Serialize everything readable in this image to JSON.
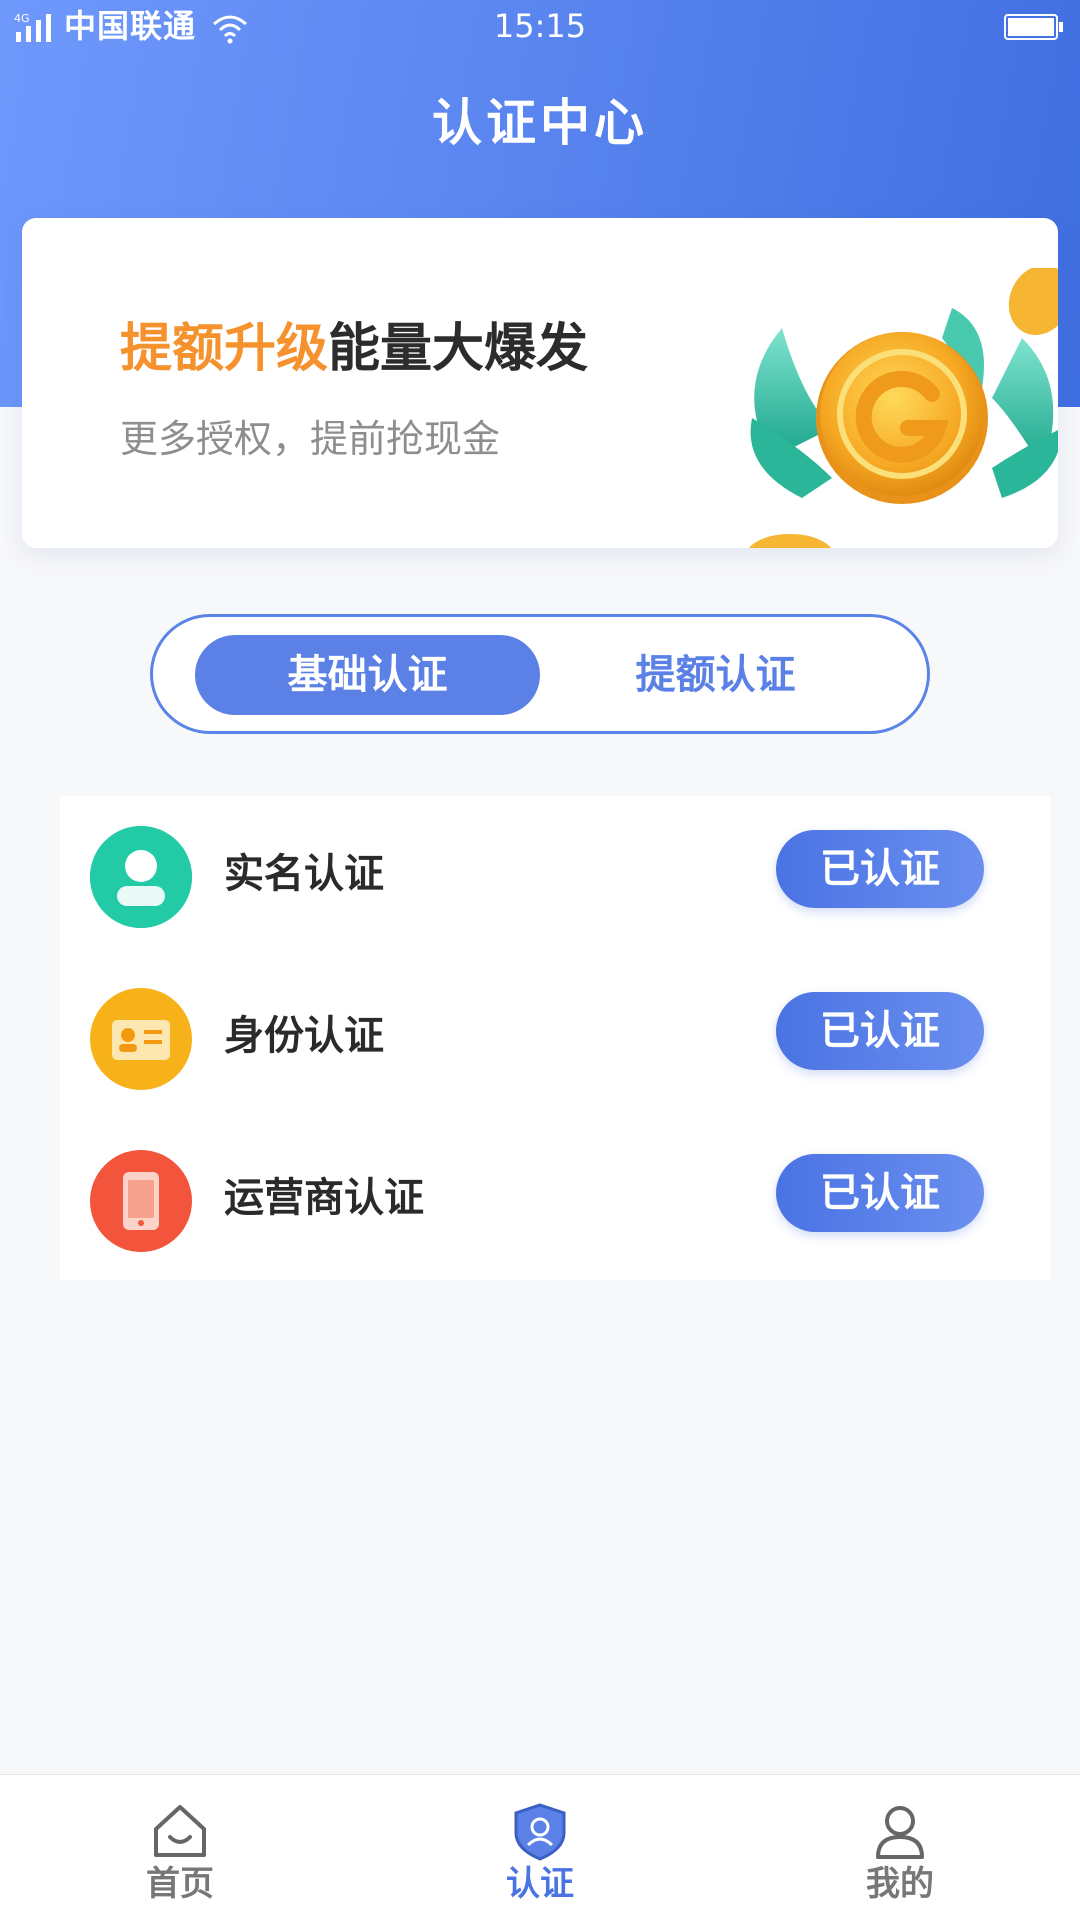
{
  "status_bar": {
    "network": "4G",
    "carrier": "中国联通",
    "time": "15:15"
  },
  "header": {
    "title": "认证中心"
  },
  "banner": {
    "headline_highlight": "提额升级",
    "headline_rest": "能量大爆发",
    "subtitle": "更多授权，提前抢现金",
    "highlight_color": "#f5922e"
  },
  "tabs": [
    {
      "label": "基础认证",
      "active": true
    },
    {
      "label": "提额认证",
      "active": false
    }
  ],
  "verifications": [
    {
      "label": "实名认证",
      "status": "已认证",
      "icon": "person-icon",
      "color": "#1fc8a0"
    },
    {
      "label": "身份认证",
      "status": "已认证",
      "icon": "id-card-icon",
      "color": "#f7b21a"
    },
    {
      "label": "运营商认证",
      "status": "已认证",
      "icon": "phone-icon",
      "color": "#f2553c"
    }
  ],
  "bottom_nav": [
    {
      "label": "首页",
      "icon": "home-icon",
      "active": false
    },
    {
      "label": "认证",
      "icon": "shield-user-icon",
      "active": true
    },
    {
      "label": "我的",
      "icon": "profile-icon",
      "active": false
    }
  ],
  "colors": {
    "primary": "#5b80e6",
    "header_gradient_start": "#6e98fb",
    "header_gradient_end": "#3f6ee0"
  }
}
